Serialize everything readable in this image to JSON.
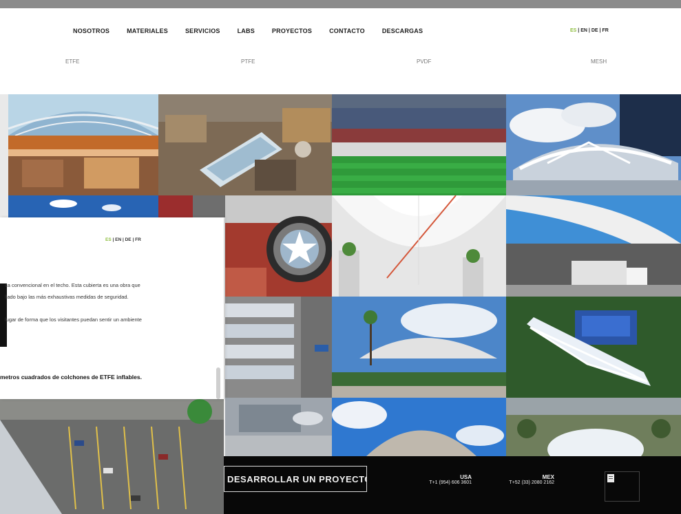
{
  "nav": {
    "items": [
      "NOSOTROS",
      "MATERIALES",
      "SERVICIOS",
      "LABS",
      "PROYECTOS",
      "CONTACTO",
      "DESCARGAS"
    ]
  },
  "lang": {
    "es": "ES",
    "en": "EN",
    "de": "DE",
    "fr": "FR",
    "sep": "|"
  },
  "materials": {
    "etfe": "ETFE",
    "ptfe": "PTFE",
    "pvdf": "PVDF",
    "mesh": "MESH"
  },
  "overlay": {
    "line1": "ca convencional en el techo. Esta cubierta es una obra que",
    "line2": "llado bajo las más exhaustivas medidas de seguridad.",
    "line3": "lugar de forma que los visitantes puedan sentir un ambiente",
    "bold_line": "metros cuadrados de colchones de ETFE inflables."
  },
  "footer": {
    "cta_label": "DESARROLLAR UN PROYECTO",
    "offices": [
      {
        "country": "USA",
        "phone": "T+1 (954) 606 3601"
      },
      {
        "country": "MEX",
        "phone": "T+52 (33) 2080 2162"
      }
    ]
  },
  "colors": {
    "accent_green": "#8cbd3c",
    "footer_bg": "#080808",
    "header_bg": "#ffffff"
  }
}
